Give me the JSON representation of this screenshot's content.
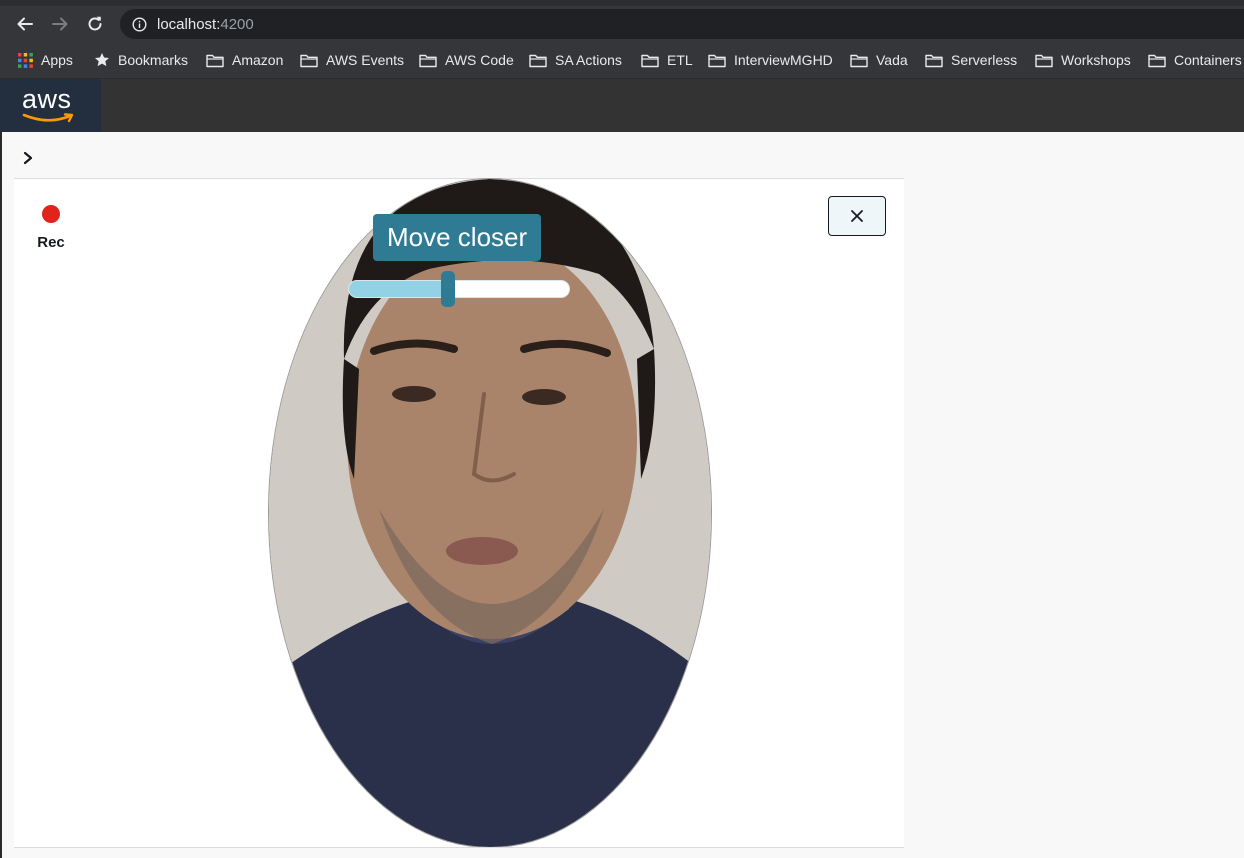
{
  "browser": {
    "url_host": "localhost:",
    "url_port": "4200",
    "bookmarks": [
      {
        "label": "Apps",
        "icon": "apps-grid-icon"
      },
      {
        "label": "Bookmarks",
        "icon": "star-icon"
      },
      {
        "label": "Amazon",
        "icon": "folder-icon"
      },
      {
        "label": "AWS Events",
        "icon": "folder-icon"
      },
      {
        "label": "AWS Code",
        "icon": "folder-icon"
      },
      {
        "label": "SA Actions",
        "icon": "folder-icon"
      },
      {
        "label": "ETL",
        "icon": "folder-icon"
      },
      {
        "label": "InterviewMGHD",
        "icon": "folder-icon"
      },
      {
        "label": "Vada",
        "icon": "folder-icon"
      },
      {
        "label": "Serverless",
        "icon": "folder-icon"
      },
      {
        "label": "Workshops",
        "icon": "folder-icon"
      },
      {
        "label": "Containers",
        "icon": "folder-icon"
      }
    ]
  },
  "app": {
    "logo_text": "aws"
  },
  "liveness": {
    "rec_label": "Rec",
    "hint": "Move closer",
    "progress": 0.45,
    "colors": {
      "rec": "#e3231b",
      "hint_bg": "#2f7b94",
      "progress_fill": "#93d1e4"
    }
  }
}
